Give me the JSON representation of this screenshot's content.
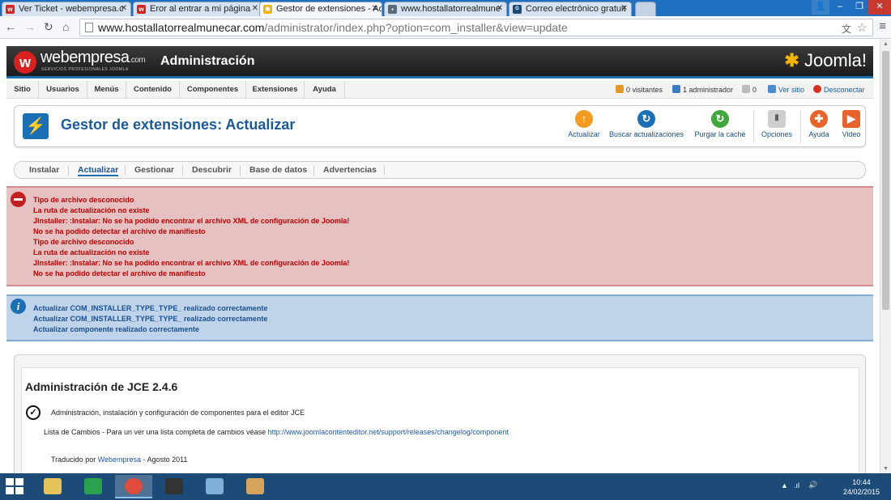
{
  "browser": {
    "tabs": [
      {
        "title": "Ver Ticket - webempresa.c",
        "icon": "webempresa-favicon"
      },
      {
        "title": "Eror al entrar a mi página",
        "icon": "webempresa-favicon"
      },
      {
        "title": "Gestor de extensiones - Ad",
        "icon": "joomla-favicon",
        "active": true
      },
      {
        "title": "www.hostallatorrealmune",
        "icon": "page-favicon"
      },
      {
        "title": "Correo electrónico gratuit",
        "icon": "gmx-favicon"
      }
    ],
    "url_host": "www.hostallatorrealmunecar.com",
    "url_rest": "/administrator/index.php?option=com_installer&view=update"
  },
  "header": {
    "logo_letter": "w",
    "brand": "webempresa",
    "brand_suffix": ".com",
    "brand_tagline": "SERVICIOS PROFESIONALES JOOMLA",
    "title": "Administración",
    "joomla_logo": "Joomla!"
  },
  "menu": {
    "items": [
      "Sitio",
      "Usuarios",
      "Menús",
      "Contenido",
      "Componentes",
      "Extensiones",
      "Ayuda"
    ],
    "status": {
      "visitors": "0 visitantes",
      "admins": "1 administrador",
      "messages": "0",
      "view_site": "Ver sitio",
      "logout": "Desconectar"
    }
  },
  "toolbar": {
    "title": "Gestor de extensiones: Actualizar",
    "buttons": [
      {
        "label": "Actualizar",
        "icon": "upload-arrow-icon"
      },
      {
        "label": "Buscar actualizaciones",
        "icon": "refresh-icon"
      },
      {
        "label": "Purgar la caché",
        "icon": "purge-icon"
      },
      {
        "label": "Opciones",
        "icon": "options-icon"
      },
      {
        "label": "Ayuda",
        "icon": "lifebuoy-icon"
      },
      {
        "label": "Video",
        "icon": "video-icon"
      }
    ]
  },
  "subnav": {
    "items": [
      "Instalar",
      "Actualizar",
      "Gestionar",
      "Descubrir",
      "Base de datos",
      "Advertencias"
    ],
    "active": "Actualizar"
  },
  "errors": [
    "Tipo de archivo desconocido",
    "La ruta de actualización no existe",
    "JInstaller: :Instalar: No se ha podido encontrar el archivo XML de configuración de Joomla!",
    "No se ha podido detectar el archivo de manifiesto",
    "Tipo de archivo desconocido",
    "La ruta de actualización no existe",
    "JInstaller: :Instalar: No se ha podido encontrar el archivo XML de configuración de Joomla!",
    "No se ha podido detectar el archivo de manifiesto"
  ],
  "messages": [
    "Actualizar COM_INSTALLER_TYPE_TYPE_ realizado correctamente",
    "Actualizar COM_INSTALLER_TYPE_TYPE_ realizado correctamente",
    "Actualizar componente realizado correctamente"
  ],
  "content": {
    "title": "Administración de JCE 2.4.6",
    "description": "Administración, instalación y configuración de componentes para el editor JCE",
    "changelog_prefix": "Lista de Cambios - Para un ver una lista completa de cambios véase ",
    "changelog_link": "http://www.joomlacontenteditor.net/support/releases/changelog/component",
    "credit_prefix": "Traducido por ",
    "credit_link": "Webempresa",
    "credit_suffix": " - Agosto 2011"
  },
  "taskbar": {
    "time": "10:44",
    "date": "24/02/2015"
  }
}
